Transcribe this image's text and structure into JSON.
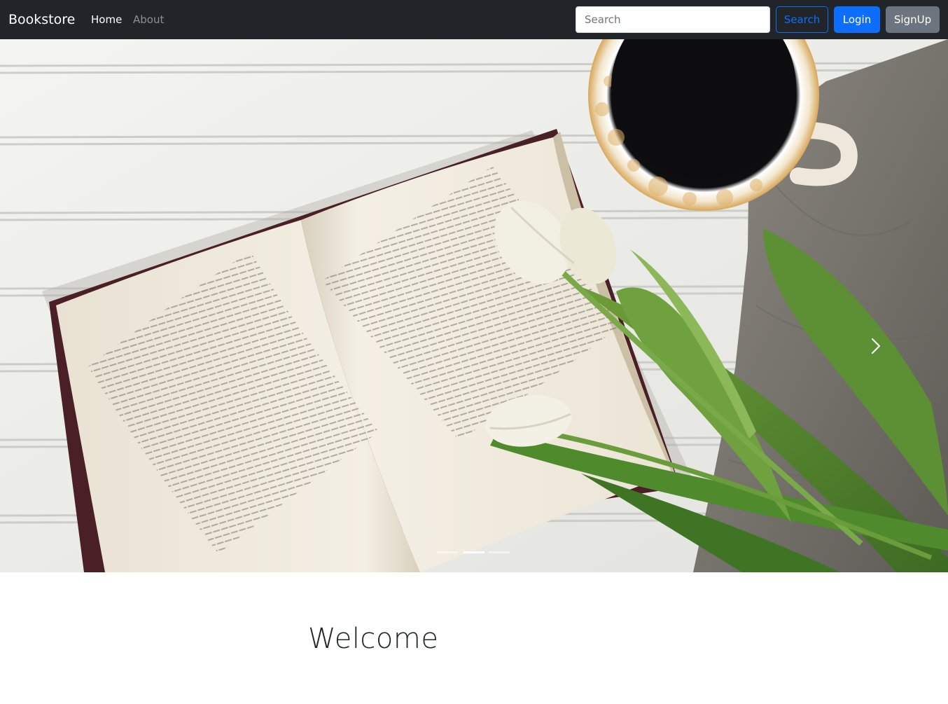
{
  "navbar": {
    "brand": "Bookstore",
    "links": [
      {
        "label": "Home",
        "active": true
      },
      {
        "label": "About",
        "active": false
      }
    ],
    "search": {
      "placeholder": "Search",
      "value": ""
    },
    "buttons": {
      "search": "Search",
      "login": "Login",
      "signup": "SignUp"
    },
    "colors": {
      "background": "#212529",
      "primary": "#0d6efd",
      "secondary": "#6c757d"
    }
  },
  "carousel": {
    "image": "open-book-with-coffee-and-tulips",
    "slide_count": 3,
    "active_slide": 2,
    "next_icon": "chevron-right-icon"
  },
  "main": {
    "heading": "Welcome"
  }
}
